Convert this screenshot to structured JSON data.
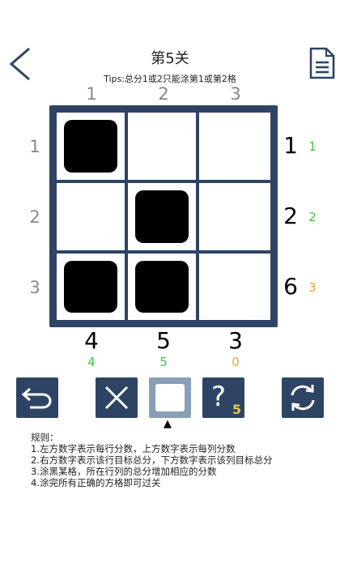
{
  "header": {
    "title": "第5关",
    "tips": "Tips:总分1或2只能涂第1或第2格"
  },
  "board": {
    "column_labels": [
      "1",
      "2",
      "3"
    ],
    "row_labels": [
      "1",
      "2",
      "3"
    ],
    "cells": [
      [
        true,
        false,
        false
      ],
      [
        false,
        true,
        false
      ],
      [
        true,
        true,
        false
      ]
    ],
    "row_targets": [
      "1",
      "2",
      "6"
    ],
    "row_current": [
      "1",
      "2",
      "3"
    ],
    "column_targets": [
      "4",
      "5",
      "3"
    ],
    "column_current": [
      "4",
      "5",
      "0"
    ]
  },
  "colors": {
    "correct": "#3ec93e",
    "incomplete": "#e8a43a",
    "board": "#2e4465",
    "hint_badge": "#e3c75a"
  },
  "toolbar": {
    "undo": "undo-arrow-icon",
    "cross": "cross-icon",
    "fill": "square-icon",
    "hint_symbol": "?",
    "hint_count": "5",
    "restart": "refresh-icon",
    "selected_tool": "fill",
    "pointer": "▲"
  },
  "rules": {
    "title": "规则：",
    "lines": [
      "1.左方数字表示每行分数，上方数字表示每列分数",
      "2.右方数字表示该行目标总分，下方数字表示该列目标总分",
      "3.涂黑某格，所在行列的总分增加相应的分数",
      "4.涂完所有正确的方格即可过关"
    ]
  }
}
